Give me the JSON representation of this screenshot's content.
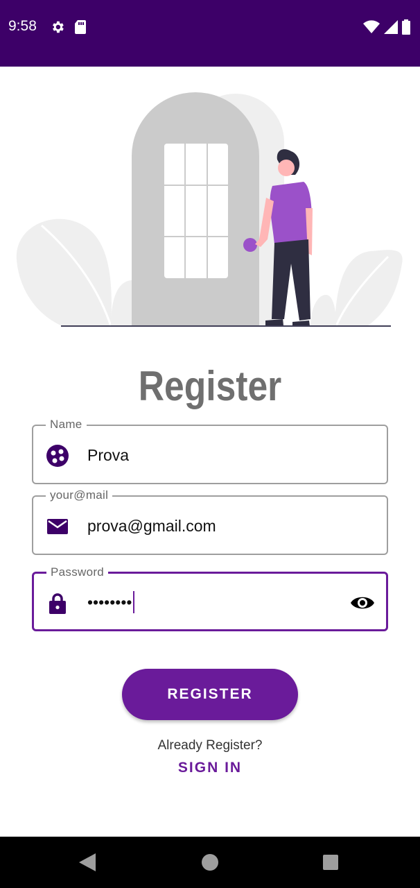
{
  "status_bar": {
    "time": "9:58",
    "left_icons": [
      "gear-icon",
      "sd-card-icon"
    ],
    "right_icons": [
      "wifi-icon",
      "signal-icon",
      "battery-icon"
    ],
    "background": "#3d0068"
  },
  "title": "Register",
  "form": {
    "name": {
      "label": "Name",
      "value": "Prova",
      "icon": "person-circle-icon"
    },
    "email": {
      "label": "your@mail",
      "value": "prova@gmail.com",
      "icon": "mail-icon"
    },
    "password": {
      "label": "Password",
      "value": "••••••••",
      "icon": "lock-icon",
      "toggle_icon": "eye-icon",
      "focused": true
    }
  },
  "register_button": {
    "label": "REGISTER"
  },
  "footer": {
    "question": "Already Register?",
    "link": "SIGN IN"
  },
  "colors": {
    "accent": "#6a1b9a",
    "title": "#6f6f6f",
    "icon": "#3d0068"
  },
  "nav_bar": {
    "icons": [
      "back-icon",
      "home-icon",
      "recents-icon"
    ]
  }
}
